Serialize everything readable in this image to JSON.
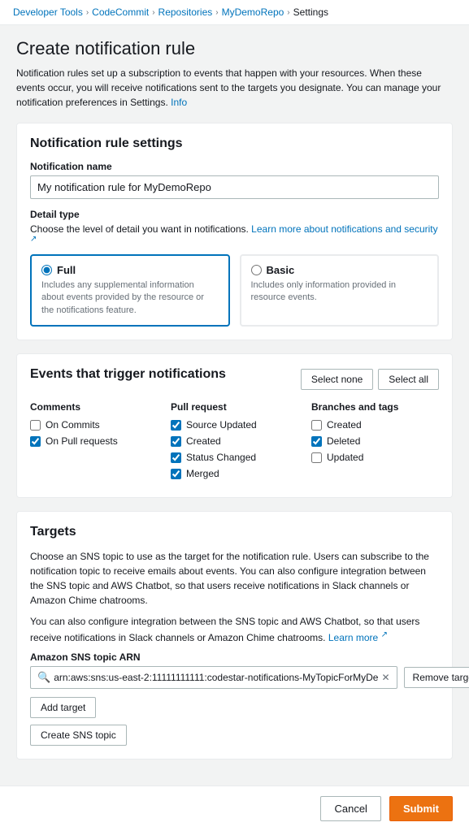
{
  "breadcrumb": {
    "items": [
      {
        "label": "Developer Tools",
        "href": "#"
      },
      {
        "label": "CodeCommit",
        "href": "#"
      },
      {
        "label": "Repositories",
        "href": "#"
      },
      {
        "label": "MyDemoRepo",
        "href": "#"
      },
      {
        "label": "Settings",
        "href": "#"
      }
    ]
  },
  "page": {
    "title": "Create notification rule",
    "description": "Notification rules set up a subscription to events that happen with your resources. When these events occur, you will receive notifications sent to the targets you designate. You can manage your notification preferences in Settings.",
    "info_link": "Info"
  },
  "notification_settings": {
    "card_title": "Notification rule settings",
    "name_label": "Notification name",
    "name_value": "My notification rule for MyDemoRepo",
    "detail_type_label": "Detail type",
    "detail_type_sublabel": "Choose the level of detail you want in notifications.",
    "detail_type_link": "Learn more about notifications and security",
    "options": [
      {
        "id": "full",
        "label": "Full",
        "description": "Includes any supplemental information about events provided by the resource or the notifications feature.",
        "selected": true
      },
      {
        "id": "basic",
        "label": "Basic",
        "description": "Includes only information provided in resource events.",
        "selected": false
      }
    ]
  },
  "events": {
    "card_title": "Events that trigger notifications",
    "select_none_label": "Select none",
    "select_all_label": "Select all",
    "columns": [
      {
        "title": "Comments",
        "items": [
          {
            "label": "On Commits",
            "checked": false
          },
          {
            "label": "On Pull requests",
            "checked": true
          }
        ]
      },
      {
        "title": "Pull request",
        "items": [
          {
            "label": "Source Updated",
            "checked": true
          },
          {
            "label": "Created",
            "checked": true
          },
          {
            "label": "Status Changed",
            "checked": true
          },
          {
            "label": "Merged",
            "checked": true
          }
        ]
      },
      {
        "title": "Branches and tags",
        "items": [
          {
            "label": "Created",
            "checked": false
          },
          {
            "label": "Deleted",
            "checked": true
          },
          {
            "label": "Updated",
            "checked": false
          }
        ]
      }
    ]
  },
  "targets": {
    "card_title": "Targets",
    "desc1": "Choose an SNS topic to use as the target for the notification rule. Users can subscribe to the notification topic to receive emails about events. You can also configure integration between the SNS topic and AWS Chatbot, so that users receive notifications in Slack channels or Amazon Chime chatrooms.",
    "desc2": "You can also configure integration between the SNS topic and AWS Chatbot, so that users receive notifications in Slack channels or Amazon Chime chatrooms.",
    "learn_more_link": "Learn more",
    "sns_label": "Amazon SNS topic ARN",
    "sns_value": "arn:aws:sns:us-east-2:11111111111:codestar-notifications-MyTopicForMyDe",
    "remove_label": "Remove target",
    "add_target_label": "Add target",
    "create_sns_label": "Create SNS topic"
  },
  "footer": {
    "cancel_label": "Cancel",
    "submit_label": "Submit"
  }
}
